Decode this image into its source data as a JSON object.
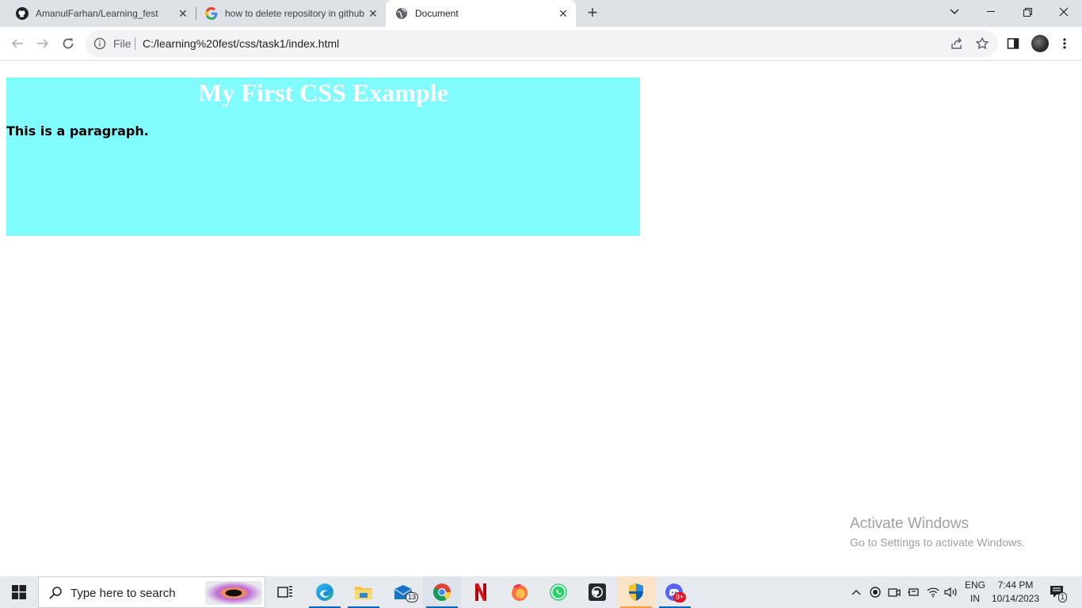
{
  "browser": {
    "tabs": [
      {
        "title": "AmanulFarhan/Learning_fest",
        "icon": "github-icon",
        "active": false
      },
      {
        "title": "how to delete repository in github",
        "icon": "google-icon",
        "active": false
      },
      {
        "title": "Document",
        "icon": "globe-icon",
        "active": true
      }
    ],
    "address": {
      "scheme_label": "File",
      "url": "C:/learning%20fest/css/task1/index.html"
    }
  },
  "page": {
    "heading": "My First CSS Example",
    "paragraph": "This is a paragraph.",
    "colors": {
      "box_background": "#80fcff",
      "heading_color": "#ffffff"
    }
  },
  "watermark": {
    "line1": "Activate Windows",
    "line2": "Go to Settings to activate Windows."
  },
  "taskbar": {
    "search_placeholder": "Type here to search",
    "apps": [
      "task-view-icon",
      "edge-icon",
      "file-explorer-icon",
      "mail-icon",
      "chrome-icon",
      "netflix-icon",
      "firefox-icon",
      "whatsapp-icon",
      "github-desktop-icon",
      "security-shield-icon",
      "discord-icon"
    ],
    "mail_badge": "13",
    "discord_badge": "9+",
    "language": {
      "line1": "ENG",
      "line2": "IN"
    },
    "time": "7:44 PM",
    "date": "10/14/2023",
    "notification_count": "1"
  }
}
